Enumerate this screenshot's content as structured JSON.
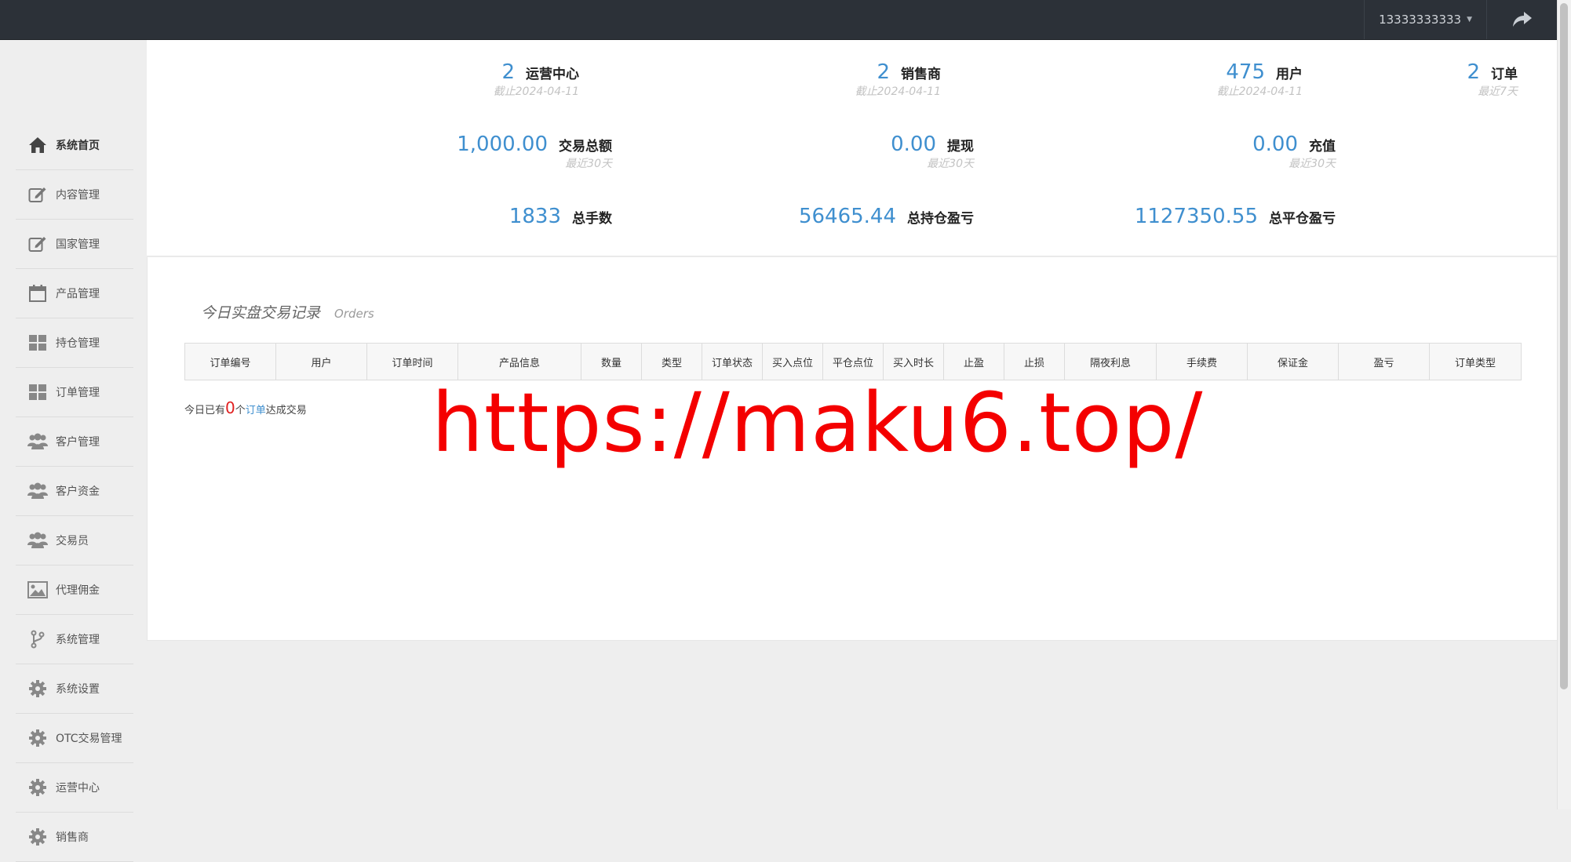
{
  "topbar": {
    "username": "13333333333"
  },
  "sidebar": {
    "items": [
      {
        "label": "系统首页",
        "icon": "home-icon"
      },
      {
        "label": "内容管理",
        "icon": "edit-icon"
      },
      {
        "label": "国家管理",
        "icon": "edit-icon"
      },
      {
        "label": "产品管理",
        "icon": "calendar-icon"
      },
      {
        "label": "持仓管理",
        "icon": "grid-icon"
      },
      {
        "label": "订单管理",
        "icon": "grid-icon"
      },
      {
        "label": "客户管理",
        "icon": "users-icon"
      },
      {
        "label": "客户资金",
        "icon": "users-icon"
      },
      {
        "label": "交易员",
        "icon": "users-icon"
      },
      {
        "label": "代理佣金",
        "icon": "image-icon"
      },
      {
        "label": "系统管理",
        "icon": "branch-icon"
      },
      {
        "label": "系统设置",
        "icon": "gear-icon"
      },
      {
        "label": "OTC交易管理",
        "icon": "gear-icon"
      },
      {
        "label": "运营中心",
        "icon": "gear-icon"
      },
      {
        "label": "销售商",
        "icon": "gear-icon"
      }
    ]
  },
  "stats": {
    "operation_center": {
      "value": "2",
      "label": "运营中心",
      "sub": "截止2024-04-11"
    },
    "sellers": {
      "value": "2",
      "label": "销售商",
      "sub": "截止2024-04-11"
    },
    "users": {
      "value": "475",
      "label": "用户",
      "sub": "截止2024-04-11"
    },
    "orders": {
      "value": "2",
      "label": "订单",
      "sub": "最近7天"
    },
    "total_trade": {
      "value": "1,000.00",
      "label": "交易总额",
      "sub": "最近30天"
    },
    "withdraw": {
      "value": "0.00",
      "label": "提现",
      "sub": "最近30天"
    },
    "recharge": {
      "value": "0.00",
      "label": "充值",
      "sub": "最近30天"
    },
    "total_lots": {
      "value": "1833",
      "label": "总手数"
    },
    "holding_pl": {
      "value": "56465.44",
      "label": "总持仓盈亏"
    },
    "closed_pl": {
      "value": "1127350.55",
      "label": "总平仓盈亏"
    }
  },
  "orders": {
    "title": "今日实盘交易记录",
    "subtitle": "Orders",
    "columns": [
      "订单编号",
      "用户",
      "订单时间",
      "产品信息",
      "数量",
      "类型",
      "订单状态",
      "买入点位",
      "平仓点位",
      "买入时长",
      "止盈",
      "止损",
      "隔夜利息",
      "手续费",
      "保证金",
      "盈亏",
      "订单类型"
    ],
    "today_prefix": "今日已有",
    "today_count": "0",
    "today_mid": "个",
    "today_link": "订单",
    "today_suffix": "达成交易"
  },
  "watermark": "https://maku6.top/",
  "colors": {
    "accent": "#3f8fcf",
    "topbar": "#2c3138",
    "watermark": "#f40000",
    "count": "#e02020"
  }
}
